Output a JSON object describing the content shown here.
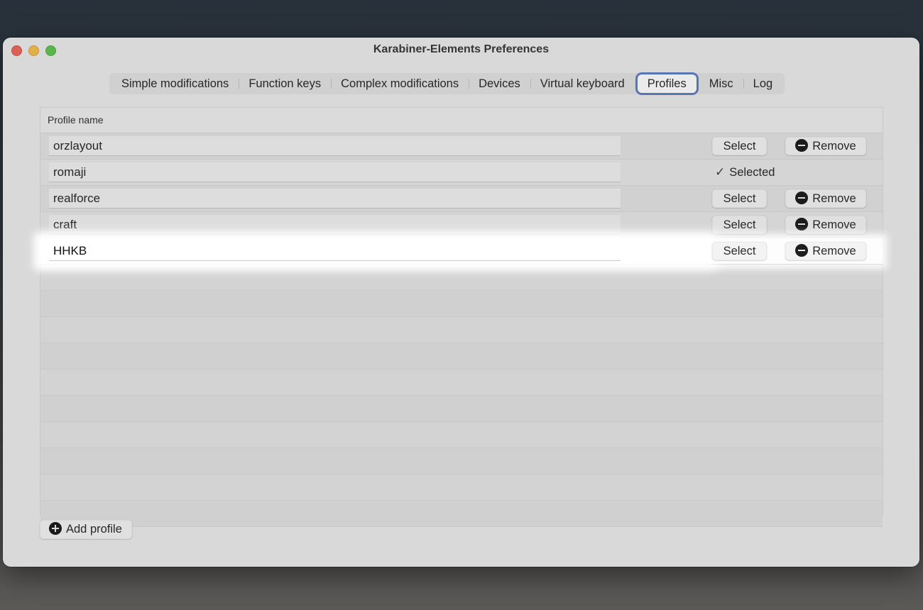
{
  "window": {
    "title": "Karabiner-Elements Preferences"
  },
  "tabs": [
    {
      "label": "Simple modifications",
      "active": false
    },
    {
      "label": "Function keys",
      "active": false
    },
    {
      "label": "Complex modifications",
      "active": false
    },
    {
      "label": "Devices",
      "active": false
    },
    {
      "label": "Virtual keyboard",
      "active": false
    },
    {
      "label": "Profiles",
      "active": true
    },
    {
      "label": "Misc",
      "active": false
    },
    {
      "label": "Log",
      "active": false
    }
  ],
  "table": {
    "header": "Profile name",
    "select_label": "Select",
    "remove_label": "Remove",
    "selected_label": "Selected",
    "profiles": [
      {
        "name": "orzlayout",
        "selected": false,
        "highlighted": false
      },
      {
        "name": "romaji",
        "selected": true,
        "highlighted": false
      },
      {
        "name": "realforce",
        "selected": false,
        "highlighted": false
      },
      {
        "name": "craft",
        "selected": false,
        "highlighted": false
      },
      {
        "name": "HHKB",
        "selected": false,
        "highlighted": true
      }
    ]
  },
  "add_profile_label": "Add profile",
  "icons": {
    "remove": "minus-circle-icon",
    "add": "plus-circle-icon",
    "selected": "checkmark-icon"
  },
  "colors": {
    "active_tab_ring": "#5f82c4",
    "close": "#ed6a5e",
    "minimize": "#f5bf4f",
    "zoom": "#61c554"
  }
}
